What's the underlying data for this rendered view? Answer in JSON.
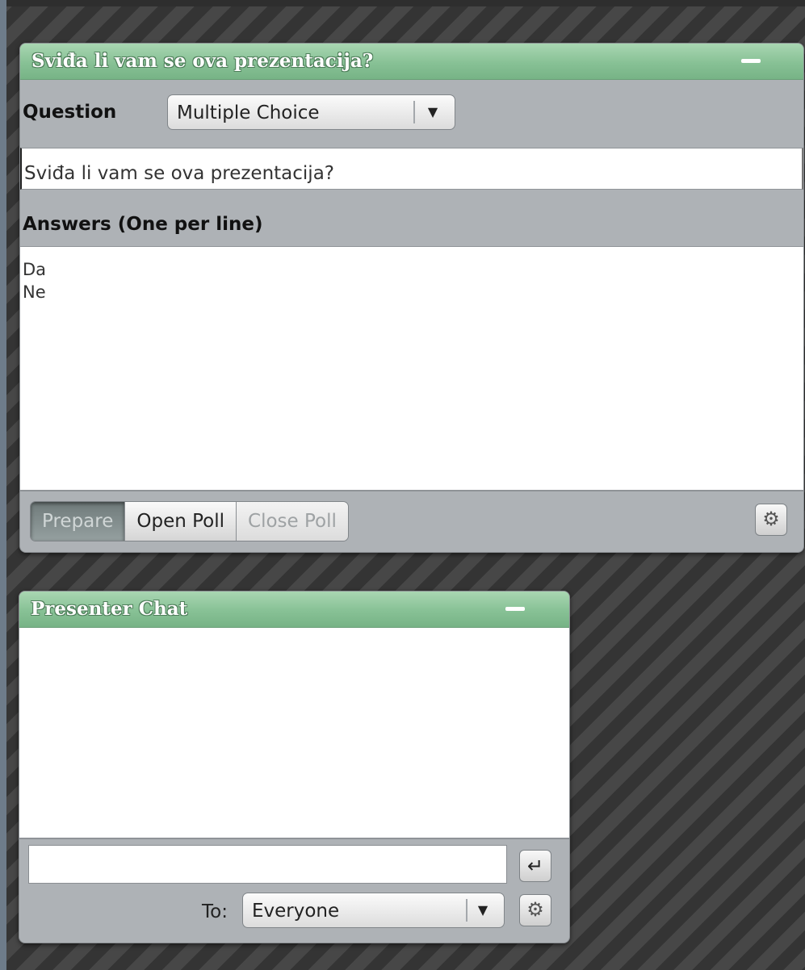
{
  "poll": {
    "title": "Sviđa li vam se ova prezentacija?",
    "question_label": "Question",
    "question_type": "Multiple Choice",
    "question_text": "Sviđa li vam se ova prezentacija?",
    "answers_label": "Answers (One per line)",
    "answers": [
      "Da",
      "Ne"
    ],
    "buttons": {
      "prepare": "Prepare",
      "open_poll": "Open Poll",
      "close_poll": "Close Poll"
    }
  },
  "chat": {
    "title": "Presenter Chat",
    "message_value": "",
    "to_label": "To:",
    "recipient": "Everyone"
  },
  "icons": {
    "minimize": "minimize-icon",
    "dropdown": "chevron-down-icon",
    "settings": "gear-icon",
    "send": "enter-icon"
  },
  "colors": {
    "header_green": "#87c195",
    "panel_gray": "#aeb2b6"
  }
}
